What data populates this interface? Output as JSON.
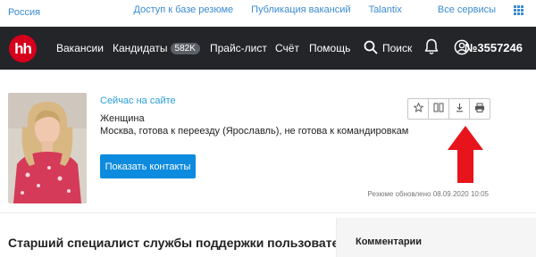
{
  "topbar": {
    "region": "Россия",
    "links": [
      "Доступ к базе резюме",
      "Публикация вакансий",
      "Talantix",
      "Все сервисы"
    ]
  },
  "nav": {
    "logo": "hh",
    "vacancies": "Вакансии",
    "candidates": "Кандидаты",
    "candidates_count": "582K",
    "pricelist": "Прайс-лист",
    "account": "Счёт",
    "help": "Помощь",
    "search": "Поиск",
    "user_id": "№3557246"
  },
  "resume": {
    "status": "Сейчас на сайте",
    "gender": "Женщина",
    "location": "Москва, готова к переезду (Ярославль), не готова к командировкам",
    "show_contacts": "Показать контакты",
    "updated": "Резюме обновлено 08.09.2020 10:05",
    "title": "Старший специалист службы поддержки пользователей"
  },
  "toolbar": {
    "icons": [
      "star-icon",
      "compare-icon",
      "download-icon",
      "print-icon"
    ]
  },
  "sidebar": {
    "comments": "Комментарии"
  },
  "colors": {
    "nav_bg": "#232529",
    "logo_red": "#d6001c",
    "link_blue": "#3a8bd1",
    "button_blue": "#0d8bde",
    "arrow_red": "#e8141c"
  }
}
